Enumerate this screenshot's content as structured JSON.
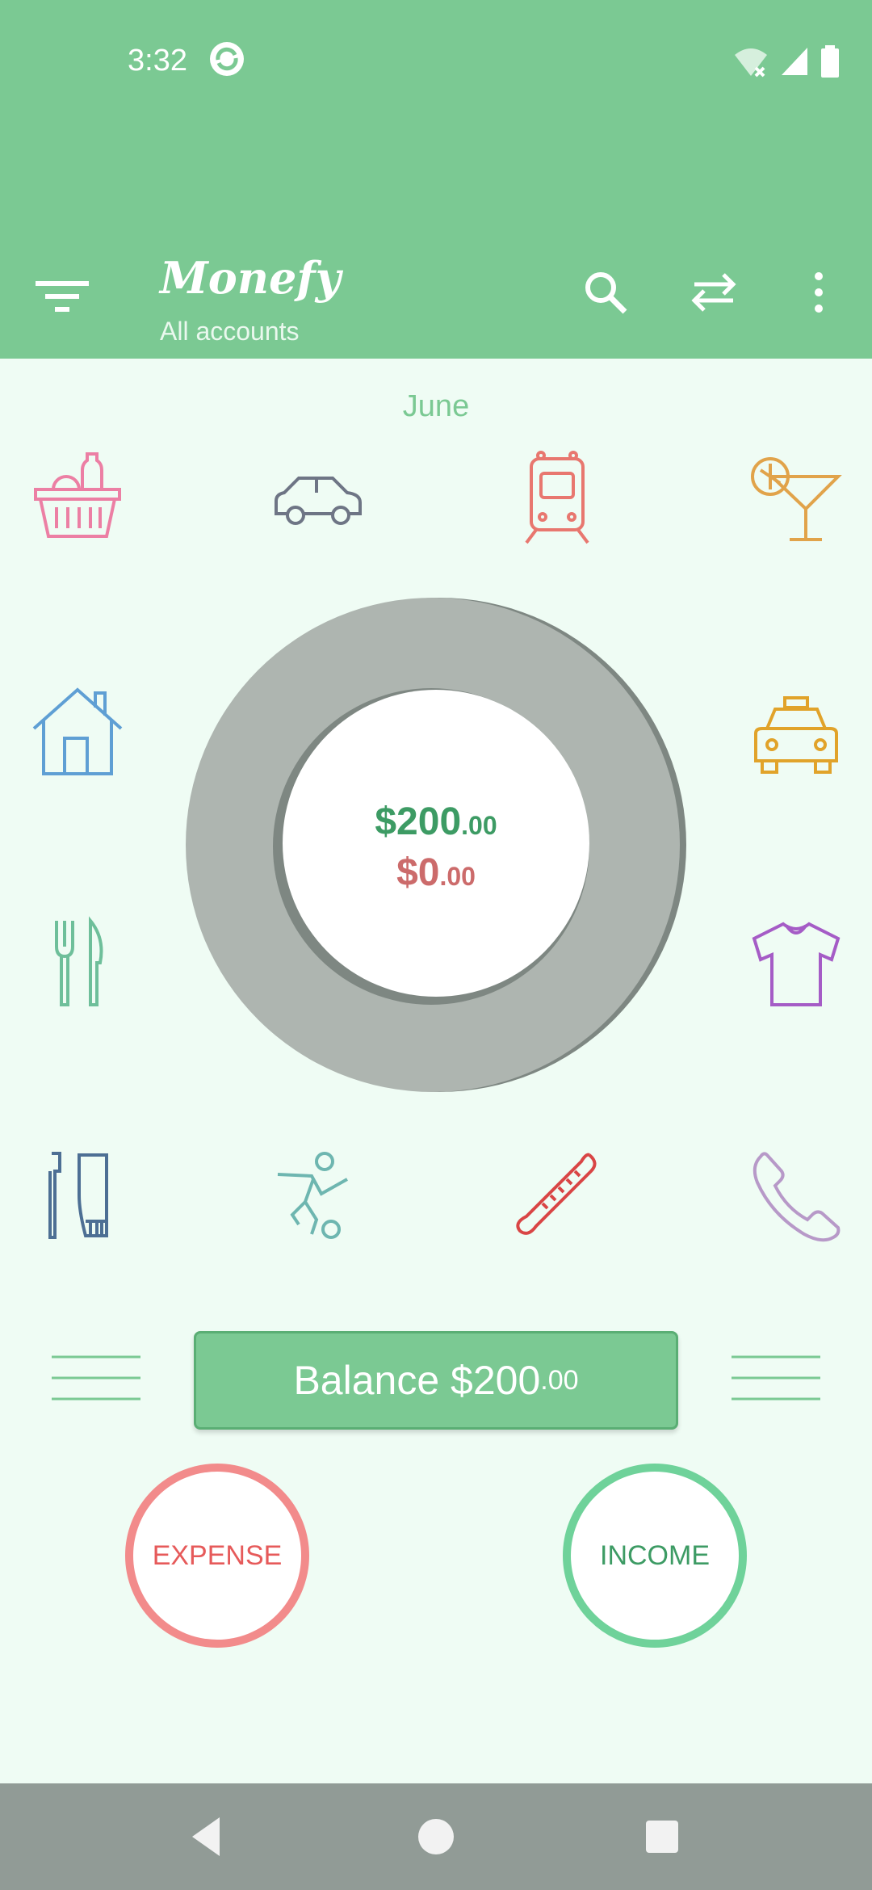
{
  "status_bar": {
    "time": "3:32"
  },
  "toolbar": {
    "title": "Monefy",
    "subtitle": "All accounts"
  },
  "month": "June",
  "summary": {
    "income_main": "$200",
    "income_cents": ".00",
    "expense_main": "$0",
    "expense_cents": ".00"
  },
  "balance": {
    "label": "Balance $200",
    "cents": ".00"
  },
  "buttons": {
    "expense": "EXPENSE",
    "income": "INCOME"
  },
  "categories": [
    "groceries-icon",
    "car-icon",
    "train-icon",
    "cocktail-icon",
    "house-icon",
    "taxi-icon",
    "restaurant-icon",
    "tshirt-icon",
    "toiletries-icon",
    "sports-icon",
    "thermometer-icon",
    "phone-icon"
  ],
  "colors": {
    "primary": "#7bc993",
    "background": "#effcf4",
    "expense": "#f28b8b",
    "income": "#6fd29a"
  }
}
